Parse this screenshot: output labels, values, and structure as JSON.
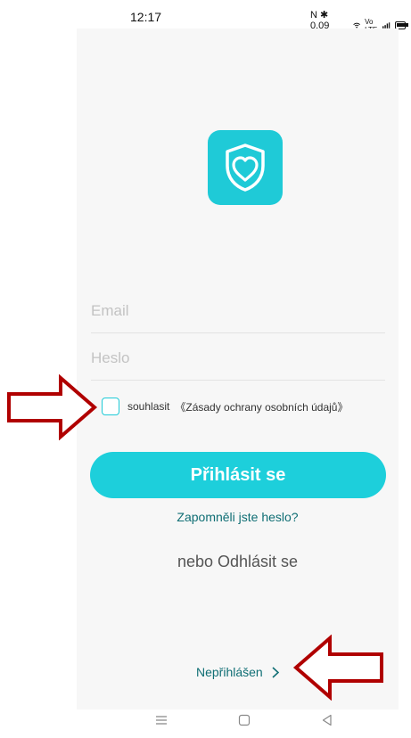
{
  "status_bar": {
    "time": "12:17",
    "icons_text": "N ✱ 0.09 KB/S",
    "network_label": "Vo LTE"
  },
  "logo": {
    "icon": "shield-heart-icon",
    "bg_color": "#1fcad7"
  },
  "form": {
    "email_placeholder": "Email",
    "password_placeholder": "Heslo"
  },
  "agree": {
    "label": "souhlasit",
    "policy_link": "《Zásady ochrany osobních údajů》"
  },
  "login_button": {
    "label": "Přihlásit se",
    "color": "#1dcfdb"
  },
  "forgot_password": "Zapomněli jste heslo?",
  "or_logout": "nebo Odhlásit se",
  "not_logged_in": "Nepřihlášen",
  "nav": {
    "menu_icon": "menu-icon",
    "home_icon": "home-icon",
    "back_icon": "back-icon"
  },
  "annotation_color": "#b00000"
}
